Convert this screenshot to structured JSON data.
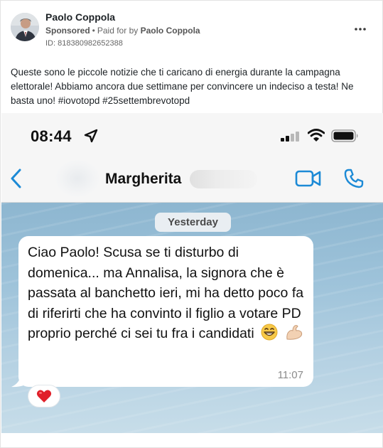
{
  "post": {
    "author_name": "Paolo Coppola",
    "sponsored_label": "Sponsored",
    "paid_for_prefix": "Paid for by",
    "paid_for_name": "Paolo Coppola",
    "ad_id": "ID: 818380982652388",
    "more_icon": "more-horizontal-icon",
    "text": "Queste sono le piccole notizie che ti caricano di energia durante la campagna elettorale! Abbiamo ancora due settimane per convincere un indeciso a testa! Ne basta uno! #iovotopd #25settembrevotopd"
  },
  "phone": {
    "time": "08:44",
    "icons": [
      "location-arrow-icon",
      "signal-icon",
      "wifi-icon",
      "battery-icon"
    ],
    "contact_name": "Margherita",
    "back_icon": "chevron-left-icon",
    "video_icon": "video-call-icon",
    "call_icon": "phone-call-icon",
    "accent_color": "#1c8ad6"
  },
  "chat": {
    "date_label": "Yesterday",
    "message": "Ciao Paolo! Scusa se ti disturbo di domenica... ma Annalisa, la signora che è passata al banchetto ieri, mi ha detto poco fa di riferirti che ha convinto il figlio a votare PD proprio perché ci sei tu fra i candidati",
    "message_emojis": [
      "grinning-face-icon",
      "flexed-biceps-icon"
    ],
    "time": "11:07",
    "reaction": "heart-icon"
  }
}
